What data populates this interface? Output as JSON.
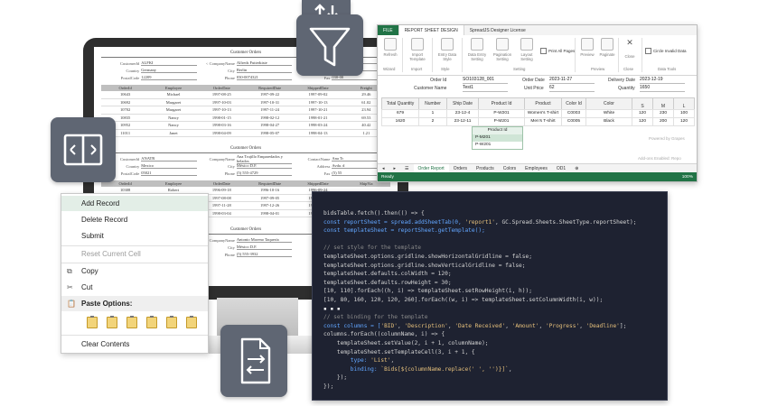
{
  "colors": {
    "accent_green": "#217346",
    "tile_gray": "#5f6673",
    "code_bg": "#1e2231",
    "menu_selected": "#e3eee7"
  },
  "icons": [
    "sort-arrows-icon",
    "filter-funnel-icon",
    "panel-layout-icon",
    "document-transfer-icon",
    "copy-icon",
    "cut-icon",
    "paste-icon"
  ],
  "printout": {
    "title": "Customer Orders",
    "form1": {
      "fields": [
        {
          "k": "CustomerId",
          "v": "ALFKI"
        },
        {
          "k": "< CompanyName",
          "v": "Alfreds Futterkiste"
        },
        {
          "k": "ContactName",
          "v": ""
        },
        {
          "k": "Country",
          "v": "Germany"
        },
        {
          "k": "City",
          "v": "Berlin"
        },
        {
          "k": "Address",
          "v": ""
        },
        {
          "k": "PostalCode",
          "v": "12209"
        },
        {
          "k": "Phone",
          "v": "030-0074321"
        },
        {
          "k": "Fax",
          "v": "030-00"
        }
      ],
      "head": [
        "OrderId",
        "Employee",
        "OrderDate",
        "RequiredDate",
        "ShippedDate",
        "Freight"
      ],
      "rows": [
        [
          "10643",
          "Michael",
          "1997-08-25",
          "1997-09-22",
          "1997-09-02",
          "29.46"
        ],
        [
          "10692",
          "Margaret",
          "1997-10-03",
          "1997-10-31",
          "1997-10-13",
          "61.02"
        ],
        [
          "10702",
          "Margaret",
          "1997-10-13",
          "1997-11-24",
          "1997-10-21",
          "23.94"
        ],
        [
          "10835",
          "Nancy",
          "1998-01-15",
          "1998-02-12",
          "1998-01-21",
          "69.53"
        ],
        [
          "10952",
          "Nancy",
          "1998-03-16",
          "1998-04-27",
          "1998-03-24",
          "40.42"
        ],
        [
          "11011",
          "Janet",
          "1998-04-09",
          "1998-05-07",
          "1998-04-13",
          "1.21"
        ]
      ]
    },
    "form2": {
      "fields": [
        {
          "k": "CustomerId",
          "v": "ANATR"
        },
        {
          "k": "CompanyName",
          "v": "Ana Trujillo Emparedados y helados"
        },
        {
          "k": "ContactName",
          "v": "Ana Tr"
        },
        {
          "k": "Country",
          "v": "Mexico"
        },
        {
          "k": "City",
          "v": "México D.F."
        },
        {
          "k": "Address",
          "v": "Avda. d"
        },
        {
          "k": "PostalCode",
          "v": "05021"
        },
        {
          "k": "Phone",
          "v": "(5) 555-4729"
        },
        {
          "k": "Fax",
          "v": "(5) 55"
        }
      ],
      "head": [
        "OrderId",
        "Employee",
        "OrderDate",
        "RequiredDate",
        "ShippedDate",
        "ShipVia"
      ],
      "rows": [
        [
          "10308",
          "Robert",
          "1996-09-18",
          "1996-10-16",
          "1996-09-24",
          ""
        ],
        [
          "10625",
          "",
          "1997-08-08",
          "1997-09-05",
          "1997-08-14",
          ""
        ],
        [
          "10759",
          "",
          "1997-11-28",
          "1997-12-26",
          "1997-12-12",
          ""
        ],
        [
          "10926",
          "",
          "1998-03-04",
          "1998-04-01",
          "1998-03-11",
          ""
        ]
      ]
    },
    "form3": {
      "fields": [
        {
          "k": "",
          "v": ""
        },
        {
          "k": "CompanyName",
          "v": "Antonio Moreno Taquería"
        },
        {
          "k": "",
          "v": ""
        },
        {
          "k": "",
          "v": ""
        },
        {
          "k": "City",
          "v": "México D.F."
        },
        {
          "k": "",
          "v": ""
        },
        {
          "k": "",
          "v": ""
        },
        {
          "k": "Phone",
          "v": "(5) 555-3932"
        },
        {
          "k": "",
          "v": ""
        }
      ]
    }
  },
  "sheet": {
    "tabs": [
      "FILE",
      "REPORT SHEET DESIGN",
      "SpreadJS Designer License"
    ],
    "ribbon_buttons": [
      "Refresh",
      "Import Template",
      "Entry Data Style",
      "Data Entry Setting",
      "Pagination Setting",
      "Layout Setting",
      "Preview",
      "Paginate",
      "Close"
    ],
    "ribbon_groups": [
      "Wizard",
      "Import",
      "Style",
      "Setting",
      "Preview",
      "Close",
      "Data Tools"
    ],
    "print_all_pages": "Print All Pages",
    "circle_invalid": "Circle Invalid Data",
    "fields": [
      {
        "label": "Order Id",
        "value": "SO103128_001"
      },
      {
        "label": "Customer Name",
        "value": "Test1"
      },
      {
        "label": "Order Date",
        "value": "2023-11-27"
      },
      {
        "label": "Unit Price",
        "value": "62"
      },
      {
        "label": "Delivery Date",
        "value": "2023-12-19"
      },
      {
        "label": "Quantity",
        "value": "1650"
      }
    ],
    "columns": [
      "Total Quantity",
      "Number",
      "Ship Date",
      "Product Id",
      "Product",
      "Color Id",
      "Color",
      "S",
      "M",
      "L"
    ],
    "rows": [
      [
        "679",
        "1",
        "23-12-4",
        "P-W201",
        "Women's T-shirt",
        "C0003",
        "White",
        "120",
        "230",
        "100"
      ],
      [
        "1620",
        "2",
        "23-12-11",
        "P-M201",
        "Men's T-shirt",
        "C0005",
        "Black",
        "120",
        "200",
        "120"
      ]
    ],
    "dropdown_header": "Product Id",
    "dropdown_items": [
      "P-M201",
      "P-W201"
    ],
    "powered": "Powered by Grapes",
    "addon": "Add-ons Enabled: Repo",
    "sheet_tabs": [
      "Order Report",
      "Orders",
      "Products",
      "Colors",
      "Employees",
      "OD1"
    ],
    "status_left": "Ready",
    "status_zoom": "100%"
  },
  "menu": {
    "items": [
      "Add Record",
      "Delete Record",
      "Submit",
      "Reset Current Cell",
      "Copy",
      "Cut",
      "Paste Options:",
      "Clear Contents"
    ]
  },
  "code": {
    "lines": [
      "bidsTable.fetch().then(() => {",
      "const reportSheet = spread.addSheetTab(0, 'report1', GC.Spread.Sheets.SheetType.reportSheet);",
      "const templateSheet = reportSheet.getTemplate();",
      "",
      "// set style for the template",
      "templateSheet.options.gridline.showHorizontalGridline = false;",
      "templateSheet.options.gridline.showVerticalGridline = false;",
      "templateSheet.defaults.colWidth = 120;",
      "templateSheet.defaults.rowHeight = 30;",
      "[10, 110].forEach((h, i) => templateSheet.setRowHeight(i, h));",
      "[10, 80, 160, 120, 120, 260].forEach((w, i) => templateSheet.setColumnWidth(i, w));",
      "▪ ▪ ▪",
      "// set binding for the template",
      "const columns = ['BID', 'Description', 'Date Received', 'Amount', 'Progress', 'Deadline'];",
      "columns.forEach((columnName, i) => {",
      "    templateSheet.setValue(2, i + 1, columnName);",
      "    templateSheet.setTemplateCell(3, i + 1, {",
      "        type: 'List',",
      "        binding: `Bids[${columnName.replace(' ', '')}]`,",
      "    });",
      "});"
    ]
  }
}
